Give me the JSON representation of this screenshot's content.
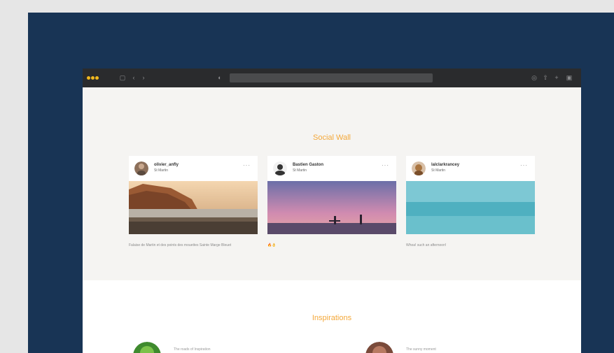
{
  "browser": {
    "icons": [
      "sidebar-icon",
      "back-icon",
      "forward-icon",
      "shield-icon",
      "download-icon",
      "share-icon",
      "add-tab-icon",
      "tabs-icon"
    ]
  },
  "social_wall": {
    "title": "Social Wall",
    "posts": [
      {
        "username": "olivier_anfly",
        "location": "St Martin",
        "more": "···",
        "meta": "",
        "caption": "Falaise de Martin et des points des mouettes Sainte Marge Bleuet"
      },
      {
        "username": "Bastien Gaston",
        "location": "St Martin",
        "more": "···",
        "meta": "",
        "caption": "🔥👌"
      },
      {
        "username": "lalclarkrancey",
        "location": "St Martin",
        "more": "···",
        "meta": "",
        "caption": "Whoa! such an afternoon!"
      }
    ]
  },
  "inspirations": {
    "title": "Inspirations",
    "items": [
      {
        "label": "The roads of Inspiration"
      },
      {
        "label": "The sunny moment"
      }
    ]
  },
  "colors": {
    "page_bg": "#e6e6e6",
    "navy": "#183455",
    "accent": "#f4a83a",
    "titlebar": "#2a2b2d"
  }
}
